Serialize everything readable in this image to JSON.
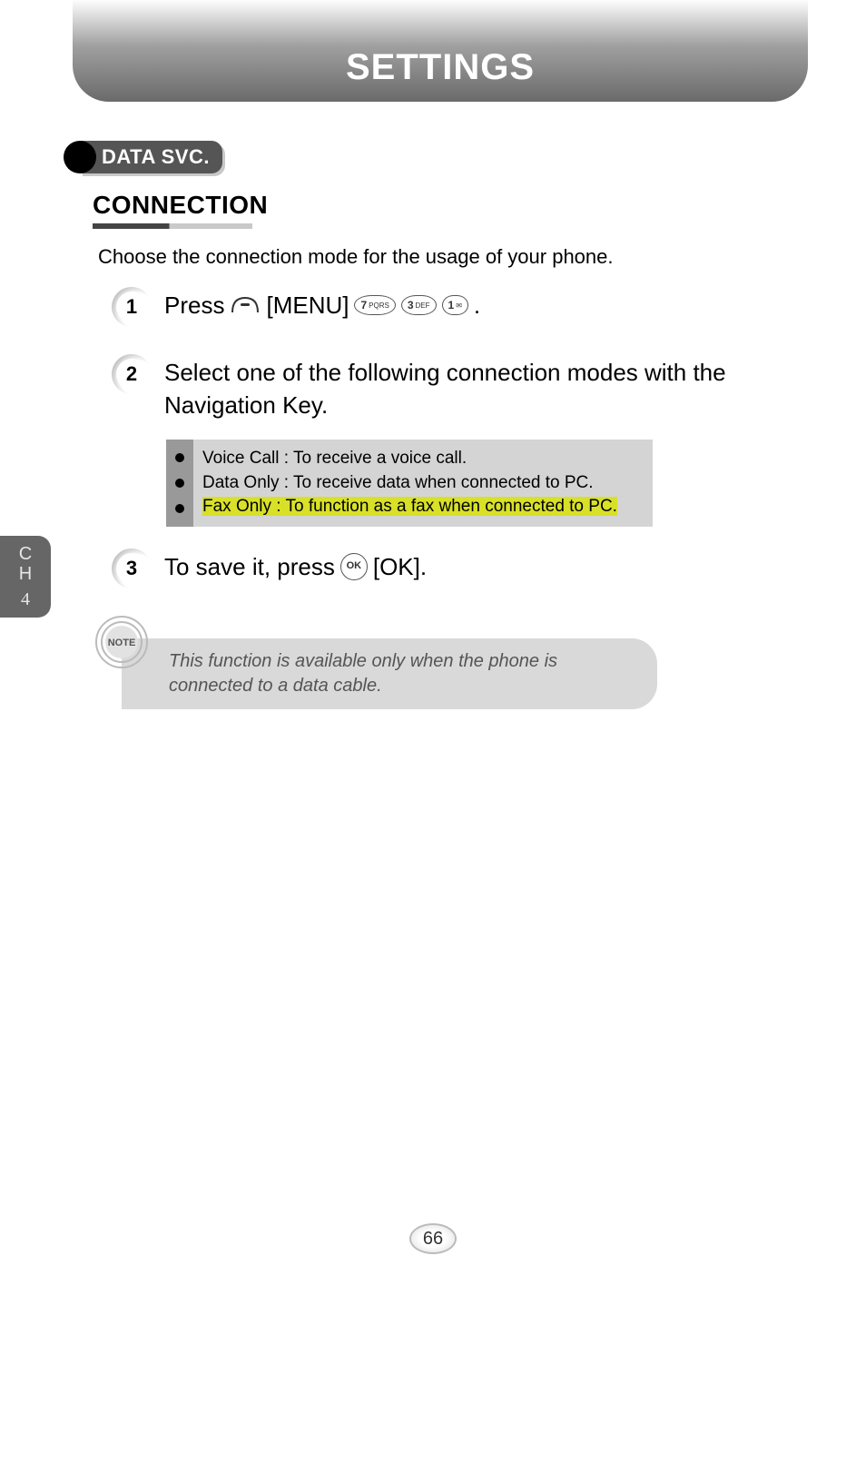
{
  "header": {
    "title": "SETTINGS"
  },
  "section": {
    "badge": "DATA SVC."
  },
  "subsection": {
    "title": "CONNECTION"
  },
  "intro": "Choose the connection mode for the usage of your phone.",
  "steps": {
    "s1": {
      "num": "1",
      "pre": "Press",
      "menu": "[MENU]",
      "dot": "."
    },
    "s2": {
      "num": "2",
      "text": "Select one of the following connection modes with the Navigation Key."
    },
    "s3": {
      "num": "3",
      "pre": "To save it, press",
      "ok": "[OK]."
    }
  },
  "keys": {
    "k7": {
      "d": "7",
      "s": "PQRS"
    },
    "k3": {
      "d": "3",
      "s": "DEF"
    },
    "k1": {
      "d": "1",
      "s": ""
    },
    "ok": "OK"
  },
  "options": {
    "o1": "Voice Call : To receive a voice call.",
    "o2": "Data Only : To receive data when connected to PC.",
    "o3": "Fax Only : To function as a fax when connected to PC."
  },
  "note": {
    "label": "NOTE",
    "text": "This function is available only when the phone is connected to a data cable."
  },
  "chapter": {
    "line1": "C",
    "line2": "H",
    "num": "4"
  },
  "page": "66"
}
